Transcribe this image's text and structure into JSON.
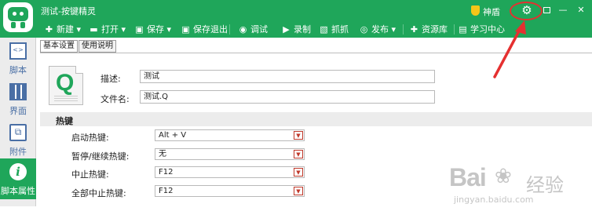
{
  "window": {
    "title": "测试-按键精灵",
    "shield_label": "神盾"
  },
  "toolbar": {
    "items": [
      {
        "label": "新建",
        "icon": "plus-icon",
        "dropdown": true
      },
      {
        "label": "打开",
        "icon": "folder-icon",
        "dropdown": true
      },
      {
        "label": "保存",
        "icon": "save-icon",
        "dropdown": true
      },
      {
        "label": "保存退出",
        "icon": "save-exit-icon",
        "dropdown": false
      },
      {
        "label": "调试",
        "icon": "debug-icon",
        "dropdown": false
      },
      {
        "label": "录制",
        "icon": "record-icon",
        "dropdown": false
      },
      {
        "label": "抓抓",
        "icon": "capture-icon",
        "dropdown": false
      },
      {
        "label": "发布",
        "icon": "publish-icon",
        "dropdown": true
      },
      {
        "label": "资源库",
        "icon": "library-icon",
        "dropdown": false
      },
      {
        "label": "学习中心",
        "icon": "book-icon",
        "dropdown": false
      }
    ]
  },
  "sidebar": {
    "items": [
      {
        "label": "脚本",
        "icon": "script-icon",
        "active": false
      },
      {
        "label": "界面",
        "icon": "ui-icon",
        "active": false
      },
      {
        "label": "附件",
        "icon": "attachment-icon",
        "active": false
      },
      {
        "label": "脚本属性",
        "icon": "info-icon",
        "active": true
      }
    ]
  },
  "tabs": [
    {
      "label": "基本设置",
      "active": true
    },
    {
      "label": "使用说明",
      "active": false
    }
  ],
  "basic": {
    "desc_label": "描述:",
    "desc_value": "测试",
    "filename_label": "文件名:",
    "filename_value": "测试.Q",
    "file_icon_letter": "Q"
  },
  "hotkeys": {
    "section_title": "热键",
    "rows": [
      {
        "label": "启动热键:",
        "value": "Alt + V"
      },
      {
        "label": "暂停/继续热键:",
        "value": "无"
      },
      {
        "label": "中止热键:",
        "value": "F12"
      },
      {
        "label": "全部中止热键:",
        "value": "F12"
      }
    ]
  },
  "watermark": {
    "brand": "Bai",
    "brand_cn": "经验",
    "url": "jingyan.baidu.com"
  },
  "colors": {
    "brand_green": "#1fa65a",
    "annotation_red": "#e53030"
  }
}
